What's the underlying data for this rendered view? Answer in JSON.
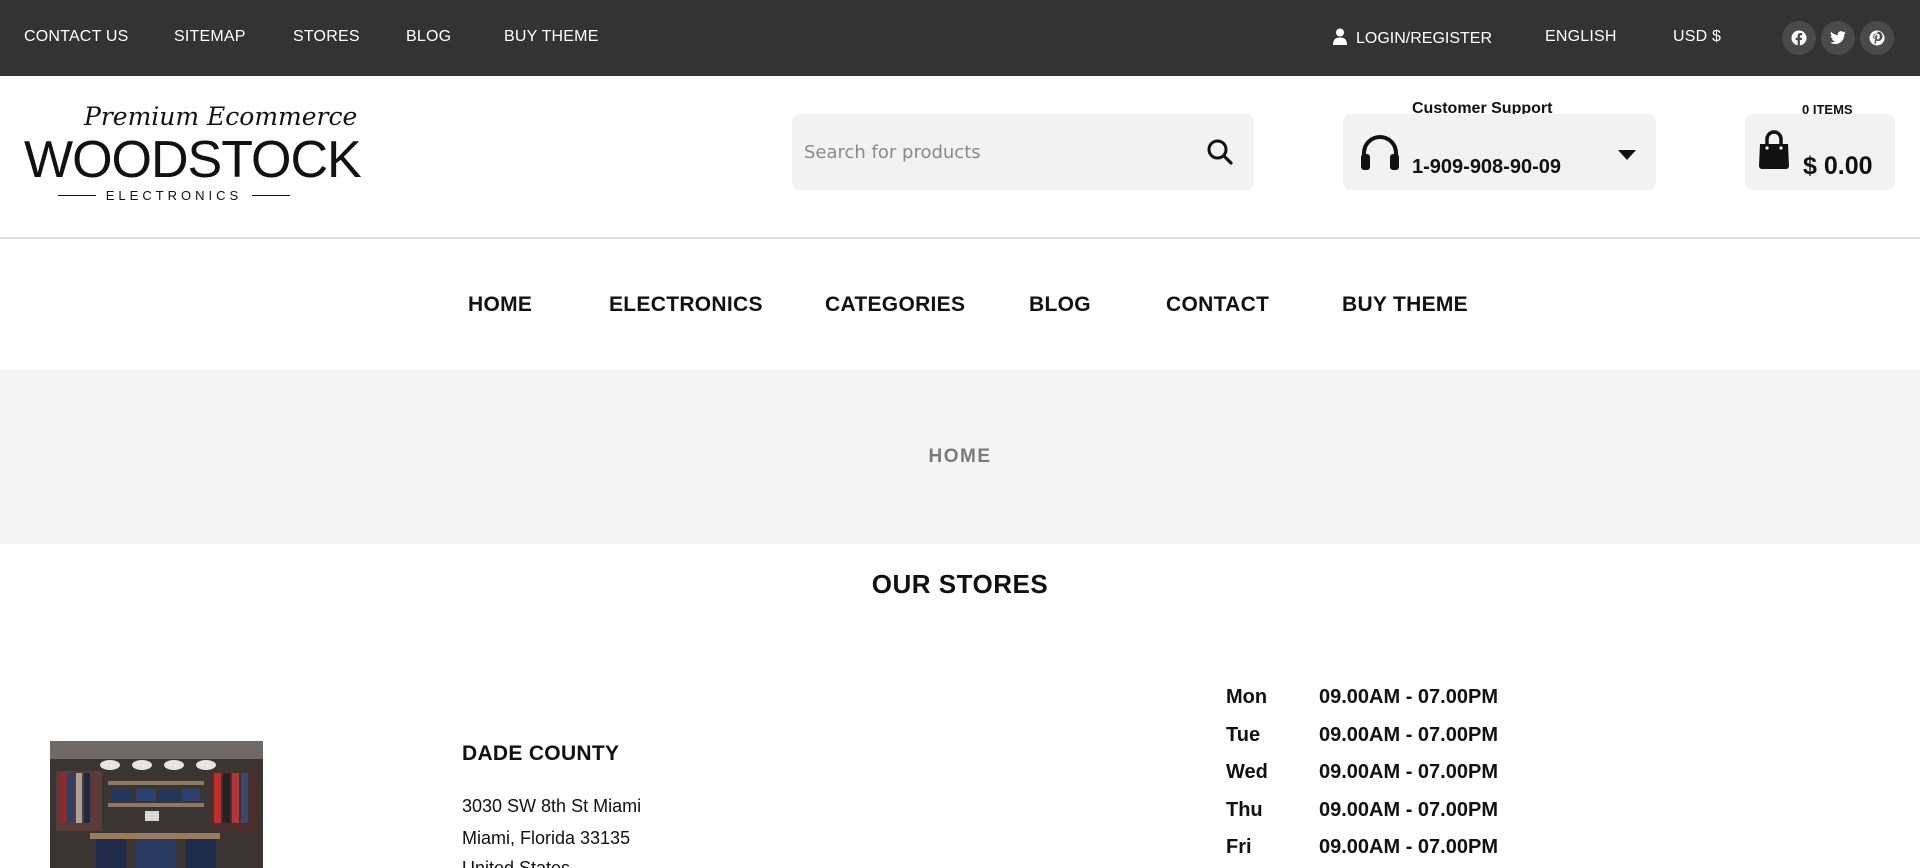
{
  "topbar": {
    "links": [
      "CONTACT US",
      "SITEMAP",
      "STORES",
      "BLOG",
      "BUY THEME"
    ],
    "login_label": "LOGIN/REGISTER",
    "language": "ENGLISH",
    "currency": "USD $",
    "social_icons": [
      "facebook-icon",
      "twitter-icon",
      "pinterest-icon"
    ]
  },
  "header": {
    "logo": {
      "tagline": "Premium Ecommerce",
      "brand": "WOODSTOCK",
      "sub": "ELECTRONICS"
    },
    "search": {
      "placeholder": "Search for products",
      "icon": "search-icon"
    },
    "support": {
      "title": "Customer Support",
      "phone": "1-909-908-90-09",
      "icon": "headphones-icon"
    },
    "cart": {
      "items_label": "0 ITEMS",
      "total": "$ 0.00",
      "icon": "shopping-bag-icon"
    }
  },
  "nav": {
    "items": [
      "HOME",
      "ELECTRONICS",
      "CATEGORIES",
      "BLOG",
      "CONTACT",
      "BUY THEME"
    ]
  },
  "breadcrumb": {
    "current": "HOME"
  },
  "stores": {
    "title": "OUR STORES",
    "store": {
      "name": "DADE COUNTY",
      "address": [
        "3030 SW 8th St Miami",
        "Miami, Florida 33135",
        "United States"
      ],
      "hours": [
        {
          "day": "Mon",
          "time": "09.00AM - 07.00PM"
        },
        {
          "day": "Tue",
          "time": "09.00AM - 07.00PM"
        },
        {
          "day": "Wed",
          "time": "09.00AM - 07.00PM"
        },
        {
          "day": "Thu",
          "time": "09.00AM - 07.00PM"
        },
        {
          "day": "Fri",
          "time": "09.00AM - 07.00PM"
        }
      ]
    }
  },
  "colors": {
    "topbar_bg": "#333333",
    "panel_bg": "#f2f2f2",
    "band_bg": "#f4f4f4",
    "text": "#111111"
  }
}
